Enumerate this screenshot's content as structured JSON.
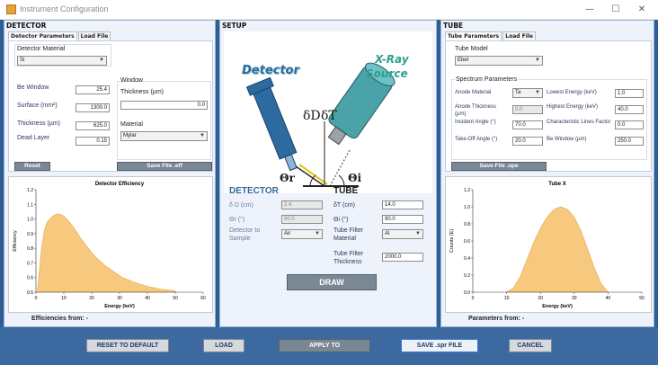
{
  "window": {
    "title": "Instrument Configuration",
    "min": "—",
    "max": "☐",
    "close": "✕"
  },
  "detector": {
    "heading": "DETECTOR",
    "tabs": [
      "Detector Parameters",
      "Load File"
    ],
    "material_label": "Detector Material",
    "material_value": "Si",
    "be_window_label": "Be Window",
    "be_window_value": "25.4",
    "surface_label": "Surface (mm²)",
    "surface_value": "1300.0",
    "thickness_label": "Thickness (µm)",
    "thickness_value": "625.0",
    "dead_layer_label": "Dead Layer",
    "dead_layer_value": "0.15",
    "window_label": "Window",
    "window_thickness_label": "Thickness (µm)",
    "window_thickness_value": "0.0",
    "window_material_label": "Material",
    "window_material_value": "Mylar",
    "reset_label": "Reset",
    "save_label": "Save File .eff",
    "efficiencies_from": "Efficiencies from: -"
  },
  "setup": {
    "heading": "SETUP",
    "detector_caption": "Detector",
    "xray_caption_1": "X-Ray",
    "xray_caption_2": "Source",
    "delta_d": "δD",
    "delta_t": "δT",
    "theta_r": "Θr",
    "theta_i": "Θi",
    "detector_heading": "DETECTOR",
    "tube_heading": "TUBE",
    "dd_label": "δ D (cm)",
    "dd_value": "2.4",
    "or_label": "Θr (°)",
    "or_value": "90.0",
    "det_to_sample_label_1": "Detector to",
    "det_to_sample_label_2": "Sample",
    "det_to_sample_value": "Air",
    "dt_label": "δT (cm)",
    "dt_value": "14.0",
    "oi_label": "Θi (°)",
    "oi_value": "90.0",
    "tube_filter_mat_label_1": "Tube Filter",
    "tube_filter_mat_label_2": "Material",
    "tube_filter_mat_value": "Al",
    "tube_filter_thk_label_1": "Tube Filter",
    "tube_filter_thk_label_2": "Thickness",
    "tube_filter_thk_value": "2000.0",
    "draw_label": "DRAW"
  },
  "tube": {
    "heading": "TUBE",
    "tabs": [
      "Tube Parameters",
      "Load File"
    ],
    "model_label": "Tube Model",
    "model_value": "Ebel",
    "spectrum_label": "Spectrum Parameters",
    "anode_material_label": "Anode Material",
    "anode_material_value": "Ta",
    "anode_thickness_label_1": "Anode Thickness",
    "anode_thickness_label_2": "(µm)",
    "anode_thickness_value": "0.0",
    "incident_angle_label": "Incident Angle (°)",
    "incident_angle_value": "70.0",
    "takeoff_label": "Take-Off Angle (°)",
    "takeoff_value": "20.0",
    "lowest_energy_label": "Lowest Energy (keV)",
    "lowest_energy_value": "1.0",
    "highest_energy_label": "Highest Energy (keV)",
    "highest_energy_value": "40.0",
    "char_lines_label": "Characteristic Lines Factor",
    "char_lines_value": "0.0",
    "be_window_label": "Be Window (µm)",
    "be_window_value": "250.0",
    "save_label": "Save File .spe",
    "parameters_from": "Parameters from: -"
  },
  "buttons": {
    "reset_default": "RESET TO DEFAULT",
    "load": "LOAD",
    "apply_to": "APPLY TO",
    "save_spr": "SAVE .spr FILE",
    "cancel": "CANCEL"
  },
  "chart_data": [
    {
      "type": "area",
      "title": "Detector Efficiency",
      "xlabel": "Energy (keV)",
      "ylabel": "Efficiency",
      "xlim": [
        0,
        60
      ],
      "ylim": [
        0.5,
        1.2
      ],
      "xticks": [
        0,
        10,
        20,
        30,
        40,
        50,
        60
      ],
      "yticks": [
        1.2,
        1.1,
        1.0,
        0.9,
        0.8,
        0.7,
        0.6,
        0.5
      ],
      "x": [
        0.5,
        1,
        2,
        3,
        4,
        5,
        6,
        7,
        8,
        9,
        10,
        12,
        14,
        16,
        18,
        20,
        22,
        25,
        28,
        31,
        35,
        40,
        45,
        50
      ],
      "y": [
        0.5,
        0.6,
        0.8,
        0.92,
        0.98,
        1.0,
        1.02,
        1.03,
        1.035,
        1.03,
        1.02,
        0.98,
        0.93,
        0.87,
        0.82,
        0.77,
        0.73,
        0.68,
        0.64,
        0.6,
        0.57,
        0.54,
        0.52,
        0.51
      ],
      "color": "#f7c97e"
    },
    {
      "type": "area",
      "title": "Tube X",
      "xlabel": "Energy (keV)",
      "ylabel": "Counts (E)",
      "xlim": [
        0,
        50
      ],
      "ylim": [
        0,
        1.2
      ],
      "xticks": [
        0,
        10,
        20,
        30,
        40,
        50
      ],
      "yticks": [
        1.2,
        1.0,
        0.8,
        0.6,
        0.4,
        0.2,
        0.0
      ],
      "x": [
        10,
        12,
        14,
        16,
        18,
        20,
        22,
        24,
        26,
        28,
        30,
        32,
        34,
        36,
        38,
        40
      ],
      "y": [
        0.0,
        0.05,
        0.18,
        0.38,
        0.58,
        0.75,
        0.88,
        0.97,
        1.0,
        0.97,
        0.88,
        0.72,
        0.5,
        0.28,
        0.1,
        0.0
      ],
      "color": "#f7c97e"
    }
  ]
}
